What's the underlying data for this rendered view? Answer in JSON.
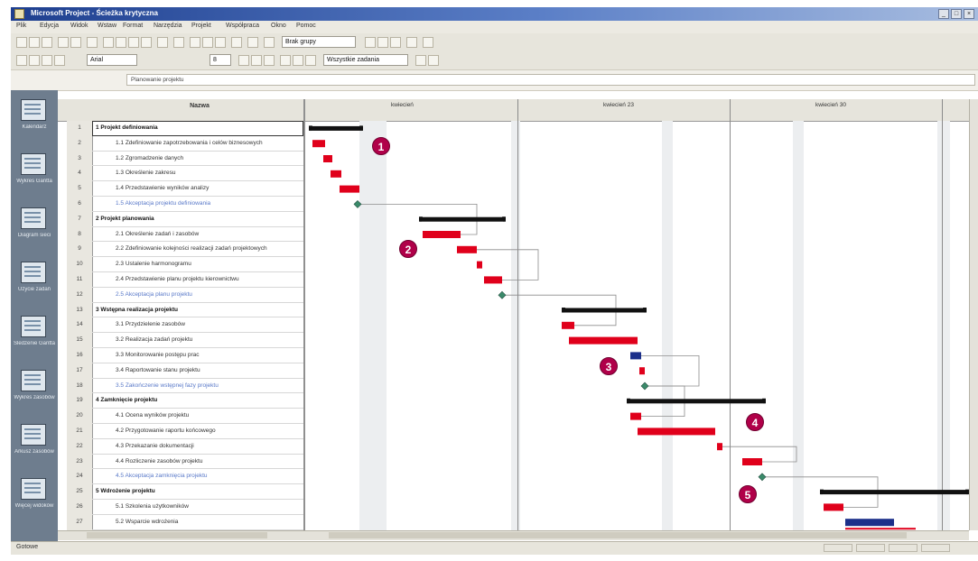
{
  "window": {
    "title": "Microsoft Project - Ścieżka krytyczna",
    "controls": [
      "_",
      "□",
      "×"
    ]
  },
  "menu": [
    "Plik",
    "Edycja",
    "Widok",
    "Wstaw",
    "Format",
    "Narzędzia",
    "Projekt",
    "Współpraca",
    "Okno",
    "Pomoc"
  ],
  "toolbar": {
    "font_select": "Arial",
    "size_select": "8",
    "group_select": "Brak grupy",
    "filter_select": "Wszystkie zadania"
  },
  "entry_bar": {
    "value": "Planowanie projektu"
  },
  "view_bar": [
    "Kalendarz",
    "Wykres Gantta",
    "Diagram sieci",
    "Użycie zadań",
    "Śledzenie Gantta",
    "Wykres zasobów",
    "Arkusz zasobów",
    "Więcej widoków"
  ],
  "sheet": {
    "column_header": "Nazwa"
  },
  "timeline": {
    "months": [
      "kwiecień",
      "kwiecień 23",
      "kwiecień 30"
    ]
  },
  "tasks": [
    {
      "id": "1",
      "name": "1 Projekt definiowania",
      "summary": true
    },
    {
      "id": "2",
      "name": "1.1 Zdefiniowanie zapotrzebowania i celów biznesowych",
      "indent": 2
    },
    {
      "id": "3",
      "name": "1.2 Zgromadzenie danych",
      "indent": 2
    },
    {
      "id": "4",
      "name": "1.3 Określenie zakresu",
      "indent": 2
    },
    {
      "id": "5",
      "name": "1.4 Przedstawienie wyników analizy",
      "indent": 2
    },
    {
      "id": "6",
      "name": "1.5 Akceptacja projektu definiowania",
      "indent": 2,
      "milestone": true
    },
    {
      "id": "7",
      "name": "2 Projekt planowania",
      "summary": true
    },
    {
      "id": "8",
      "name": "2.1 Określenie zadań i zasobów",
      "indent": 2
    },
    {
      "id": "9",
      "name": "2.2 Zdefiniowanie kolejności realizacji zadań projektowych",
      "indent": 2
    },
    {
      "id": "10",
      "name": "2.3 Ustalenie harmonogramu",
      "indent": 2
    },
    {
      "id": "11",
      "name": "2.4 Przedstawienie planu projektu kierownictwu",
      "indent": 2
    },
    {
      "id": "12",
      "name": "2.5 Akceptacja planu projektu",
      "indent": 2,
      "milestone": true
    },
    {
      "id": "13",
      "name": "3 Wstępna realizacja projektu",
      "summary": true
    },
    {
      "id": "14",
      "name": "3.1 Przydzielenie zasobów",
      "indent": 2
    },
    {
      "id": "15",
      "name": "3.2 Realizacja zadań projektu",
      "indent": 2
    },
    {
      "id": "16",
      "name": "3.3 Monitorowanie postępu prac",
      "indent": 2
    },
    {
      "id": "17",
      "name": "3.4 Raportowanie stanu projektu",
      "indent": 2
    },
    {
      "id": "18",
      "name": "3.5 Zakończenie wstępnej fazy projektu",
      "indent": 2,
      "milestone": true
    },
    {
      "id": "19",
      "name": "4 Zamknięcie projektu",
      "summary": true
    },
    {
      "id": "20",
      "name": "4.1 Ocena wyników projektu",
      "indent": 2
    },
    {
      "id": "21",
      "name": "4.2 Przygotowanie raportu końcowego",
      "indent": 2
    },
    {
      "id": "22",
      "name": "4.3 Przekazanie dokumentacji",
      "indent": 2
    },
    {
      "id": "23",
      "name": "4.4 Rozliczenie zasobów projektu",
      "indent": 2
    },
    {
      "id": "24",
      "name": "4.5 Akceptacja zamknięcia projektu",
      "indent": 2,
      "milestone": true
    },
    {
      "id": "25",
      "name": "5 Wdrożenie projektu",
      "summary": true
    },
    {
      "id": "26",
      "name": "5.1 Szkolenia użytkowników",
      "indent": 2
    },
    {
      "id": "27",
      "name": "5.2 Wsparcie wdrożenia",
      "indent": 2
    }
  ],
  "callouts": [
    "1",
    "2",
    "3",
    "4",
    "5"
  ],
  "status": {
    "text": "Gotowe"
  },
  "colors": {
    "critical": "#e0001b",
    "normal": "#1c2f8a",
    "summary": "#111111",
    "callout": "#b00049",
    "milestone": "#3a8a6a"
  }
}
